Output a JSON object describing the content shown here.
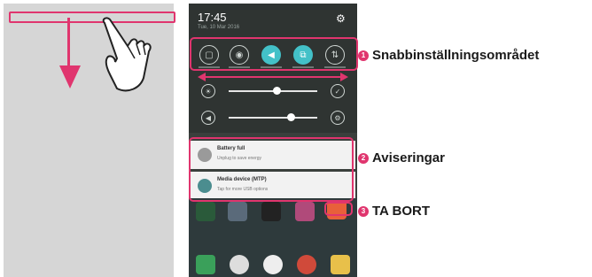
{
  "status": {
    "time": "17:45",
    "date": "Tue, 10 Mar 2016"
  },
  "notifications": [
    {
      "title": "Battery full",
      "subtitle": "Unplug to save energy"
    },
    {
      "title": "Media device (MTP)",
      "subtitle": "Tap for more USB options"
    }
  ],
  "quick_settings": [
    {
      "icon": "screen-icon",
      "glyph": "▢"
    },
    {
      "icon": "wifi-icon",
      "glyph": "◉"
    },
    {
      "icon": "sound-icon",
      "glyph": "◀"
    },
    {
      "icon": "rotate-icon",
      "glyph": "⧉"
    },
    {
      "icon": "data-icon",
      "glyph": "⇅"
    }
  ],
  "callouts": [
    {
      "number": "1",
      "label": "Snabbinställningsområdet"
    },
    {
      "number": "2",
      "label": "Aviseringar"
    },
    {
      "number": "3",
      "label": "TA BORT"
    }
  ],
  "colors": {
    "accent": "#e0356e",
    "quick_on": "#43c1c8"
  }
}
